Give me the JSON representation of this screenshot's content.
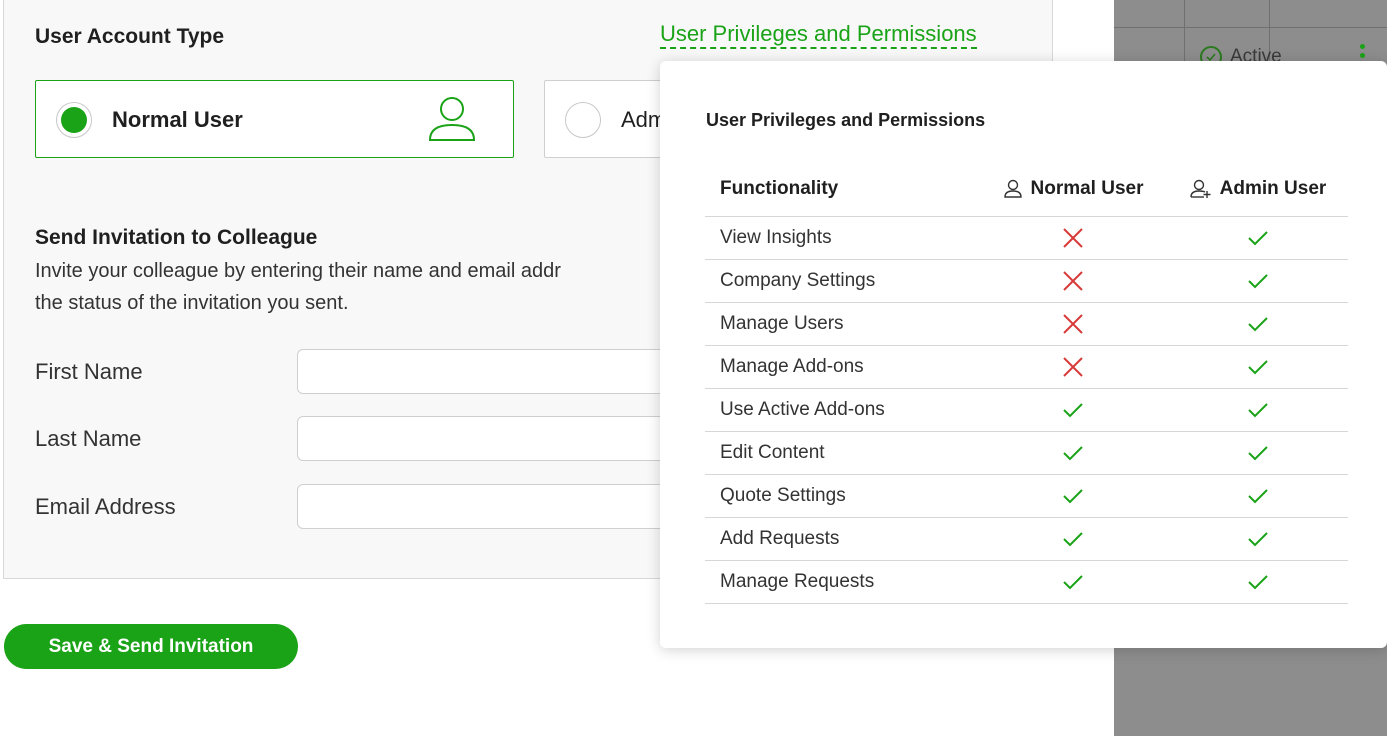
{
  "account_type": {
    "title": "User Account Type",
    "privileges_link": "User Privileges and Permissions",
    "options": [
      {
        "label": "Normal User",
        "selected": true,
        "icon": "user-icon"
      },
      {
        "label": "Adm",
        "selected": false
      }
    ]
  },
  "invitation": {
    "title": "Send Invitation to Colleague",
    "description_line1": "Invite your colleague by entering their name and email addr",
    "description_line2": "the status of the invitation you sent.",
    "fields": [
      {
        "label": "First Name",
        "value": "",
        "placeholder": ""
      },
      {
        "label": "Last Name",
        "value": "",
        "placeholder": ""
      },
      {
        "label": "Email Address",
        "value": "",
        "placeholder": ""
      }
    ],
    "submit_label": "Save & Send Invitation"
  },
  "background_table": {
    "status_label": "Active"
  },
  "popover": {
    "title": "User Privileges and Permissions",
    "headers": {
      "functionality": "Functionality",
      "normal": "Normal User",
      "admin": "Admin User"
    },
    "rows": [
      {
        "name": "View Insights",
        "normal": false,
        "admin": true
      },
      {
        "name": "Company Settings",
        "normal": false,
        "admin": true
      },
      {
        "name": "Manage Users",
        "normal": false,
        "admin": true
      },
      {
        "name": "Manage Add-ons",
        "normal": false,
        "admin": true
      },
      {
        "name": "Use Active Add-ons",
        "normal": true,
        "admin": true
      },
      {
        "name": "Edit Content",
        "normal": true,
        "admin": true
      },
      {
        "name": "Quote Settings",
        "normal": true,
        "admin": true
      },
      {
        "name": "Add Requests",
        "normal": true,
        "admin": true
      },
      {
        "name": "Manage Requests",
        "normal": true,
        "admin": true
      }
    ]
  },
  "colors": {
    "accent": "#1aa317",
    "deny": "#d93a3a",
    "overlay": "#8d8d8d",
    "card_bg": "#f8f8f8"
  }
}
